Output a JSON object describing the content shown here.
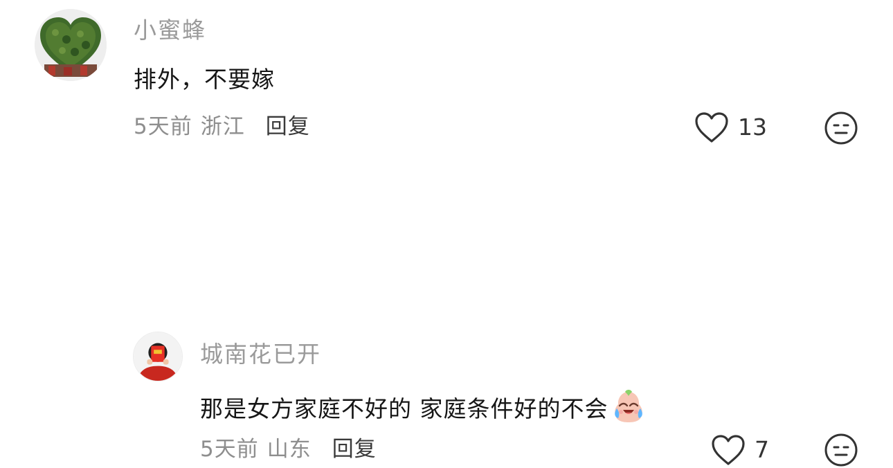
{
  "comments": [
    {
      "username": "小蜜蜂",
      "text": "排外，不要嫁",
      "time": "5天前",
      "location": "浙江",
      "reply_label": "回复",
      "likes": "13",
      "avatar_icon": "heart-shaped-topiary-avatar",
      "like_icon": "heart-outline-icon",
      "dislike_icon": "neutral-face-icon"
    },
    {
      "username": "城南花已开",
      "text": "那是女方家庭不好的 家庭条件好的不会",
      "text_emoji": "crying-laughing-emoji",
      "time": "5天前",
      "location": "山东",
      "reply_label": "回复",
      "likes": "7",
      "avatar_icon": "person-holding-red-envelope-avatar",
      "like_icon": "heart-outline-icon",
      "dislike_icon": "neutral-face-icon"
    }
  ],
  "colors": {
    "username": "#9a9a9a",
    "text": "#161616",
    "meta": "#8e8e8e",
    "icon": "#333333",
    "background": "#ffffff"
  }
}
